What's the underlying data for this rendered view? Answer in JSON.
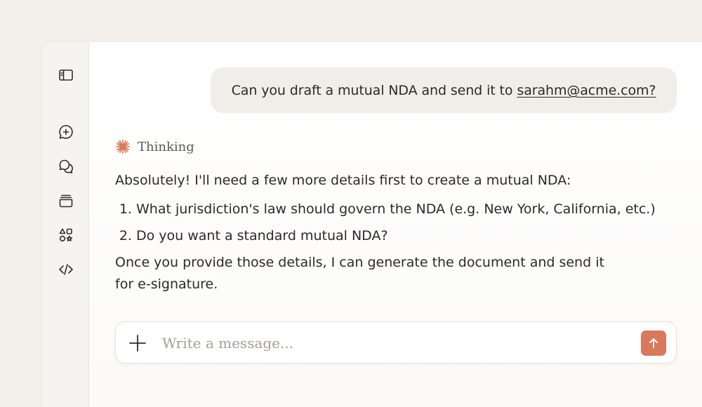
{
  "sidebar": {
    "items": [
      {
        "icon": "sidebar-toggle-icon"
      },
      {
        "icon": "new-chat-icon"
      },
      {
        "icon": "chats-icon"
      },
      {
        "icon": "projects-icon"
      },
      {
        "icon": "artifacts-icon"
      },
      {
        "icon": "code-icon"
      }
    ]
  },
  "conversation": {
    "user_message": "Can you draft a mutual NDA and send it to",
    "user_email": "sarahm@acme.com?",
    "thinking_label": "Thinking",
    "reply_intro": "Absolutely! I'll need a few more details first to create a mutual NDA:",
    "reply_items": [
      "What jurisdiction's law should govern the NDA (e.g. New York, California, etc.)",
      "Do you want a standard mutual NDA?"
    ],
    "reply_closing": "Once you provide those details, I can generate the document and send it for e-signature."
  },
  "composer": {
    "placeholder": "Write a message..."
  },
  "colors": {
    "accent": "#d9785a",
    "background": "#f3f0eb",
    "bubble": "#f0eee9"
  }
}
